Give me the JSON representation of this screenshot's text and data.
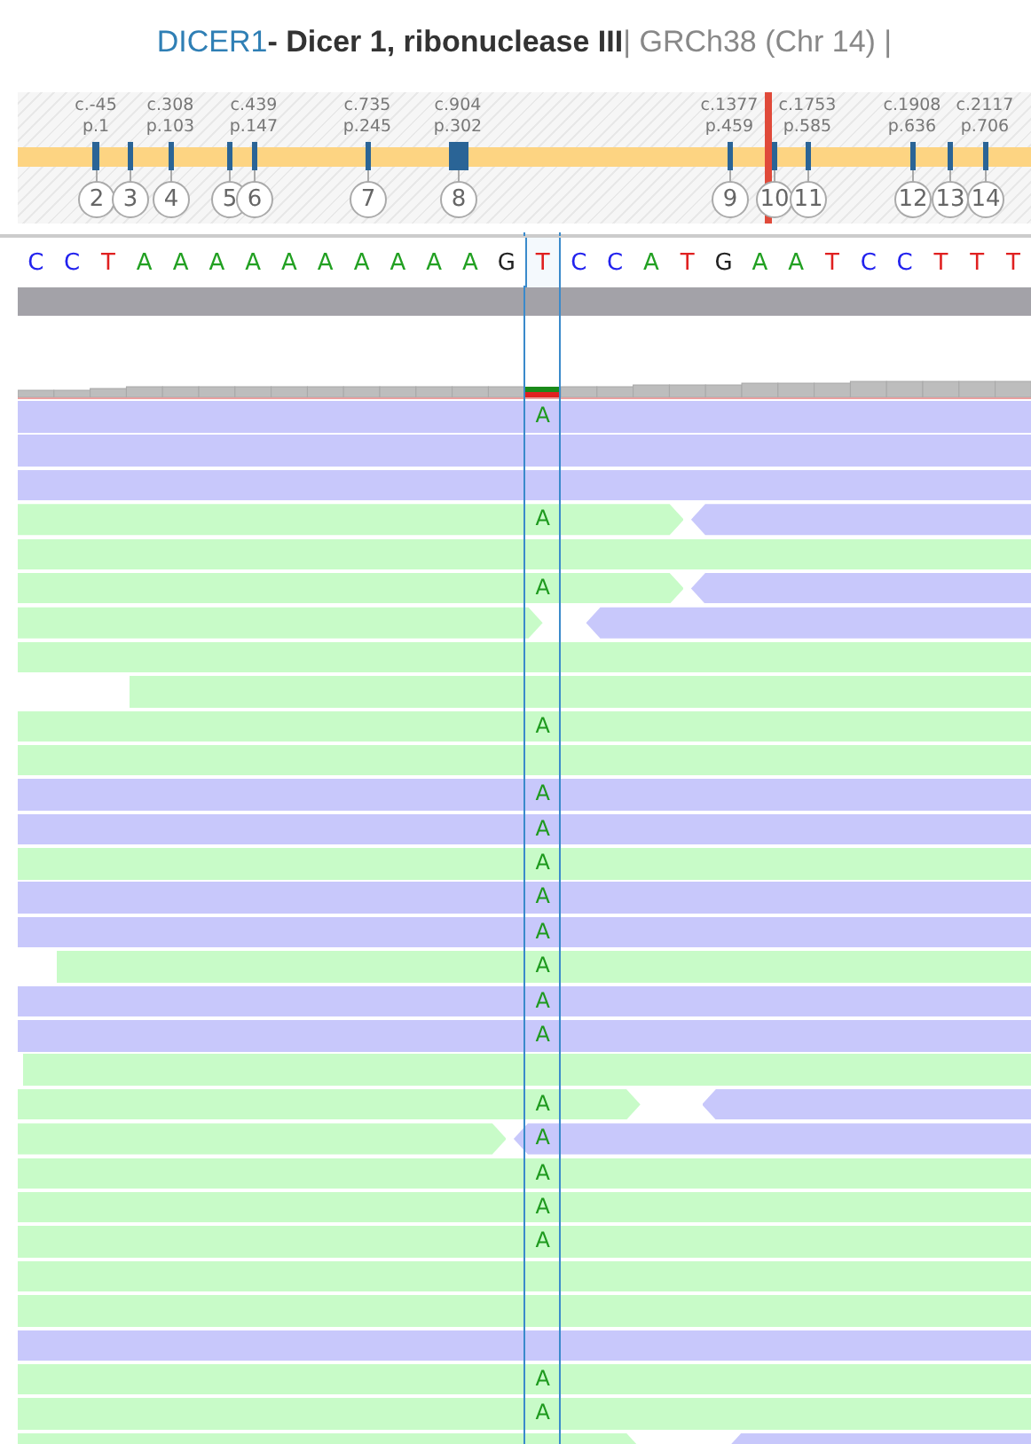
{
  "title": {
    "symbol": "DICER1",
    "name": " - Dicer 1, ribonuclease III",
    "assembly": " | GRCh38 (Chr 14) |"
  },
  "exons": [
    {
      "number": "2",
      "c_label": "c.-45",
      "p_label": "p.1"
    },
    {
      "number": "3"
    },
    {
      "number": "4",
      "c_label": "c.308",
      "p_label": "p.103"
    },
    {
      "number": "5"
    },
    {
      "number": "6",
      "c_label": "c.439",
      "p_label": "p.147"
    },
    {
      "number": "7",
      "c_label": "c.735",
      "p_label": "p.245"
    },
    {
      "number": "8",
      "c_label": "c.904",
      "p_label": "p.302"
    },
    {
      "number": "9",
      "c_label": "c.1377",
      "p_label": "p.459"
    },
    {
      "number": "10"
    },
    {
      "number": "11",
      "c_label": "c.1753",
      "p_label": "p.585"
    },
    {
      "number": "12",
      "c_label": "c.1908",
      "p_label": "p.636"
    },
    {
      "number": "13"
    },
    {
      "number": "14",
      "c_label": "c.2117",
      "p_label": "p.706"
    }
  ],
  "sequence": [
    {
      "base": "C",
      "color": "#2222ee",
      "selected": false
    },
    {
      "base": "C",
      "color": "#2222ee",
      "selected": false
    },
    {
      "base": "T",
      "color": "#e02020",
      "selected": false
    },
    {
      "base": "A",
      "color": "#22a022",
      "selected": false
    },
    {
      "base": "A",
      "color": "#22a022",
      "selected": false
    },
    {
      "base": "A",
      "color": "#22a022",
      "selected": false
    },
    {
      "base": "A",
      "color": "#22a022",
      "selected": false
    },
    {
      "base": "A",
      "color": "#22a022",
      "selected": false
    },
    {
      "base": "A",
      "color": "#22a022",
      "selected": false
    },
    {
      "base": "A",
      "color": "#22a022",
      "selected": false
    },
    {
      "base": "A",
      "color": "#22a022",
      "selected": false
    },
    {
      "base": "A",
      "color": "#22a022",
      "selected": false
    },
    {
      "base": "A",
      "color": "#22a022",
      "selected": false
    },
    {
      "base": "G",
      "color": "#222222",
      "selected": false
    },
    {
      "base": "T",
      "color": "#e02020",
      "selected": true
    },
    {
      "base": "C",
      "color": "#2222ee",
      "selected": false
    },
    {
      "base": "C",
      "color": "#2222ee",
      "selected": false
    },
    {
      "base": "A",
      "color": "#22a022",
      "selected": false
    },
    {
      "base": "T",
      "color": "#e02020",
      "selected": false
    },
    {
      "base": "G",
      "color": "#222222",
      "selected": false
    },
    {
      "base": "A",
      "color": "#22a022",
      "selected": false
    },
    {
      "base": "A",
      "color": "#22a022",
      "selected": false
    },
    {
      "base": "T",
      "color": "#e02020",
      "selected": false
    },
    {
      "base": "C",
      "color": "#2222ee",
      "selected": false
    },
    {
      "base": "C",
      "color": "#2222ee",
      "selected": false
    },
    {
      "base": "T",
      "color": "#e02020",
      "selected": false
    },
    {
      "base": "T",
      "color": "#e02020",
      "selected": false
    },
    {
      "base": "T",
      "color": "#e02020",
      "selected": false
    }
  ],
  "reads": [
    {
      "segments": [
        {
          "kind": "reverse"
        }
      ],
      "mismatch": "A"
    },
    {
      "segments": [
        {
          "kind": "reverse"
        }
      ]
    },
    {
      "segments": [
        {
          "kind": "reverse"
        }
      ]
    },
    {
      "segments": [
        {
          "kind": "forward"
        },
        {
          "kind": "reverse"
        }
      ],
      "mismatch": "A"
    },
    {
      "segments": [
        {
          "kind": "forward"
        }
      ]
    },
    {
      "segments": [
        {
          "kind": "forward"
        },
        {
          "kind": "reverse"
        }
      ],
      "mismatch": "A"
    },
    {
      "segments": [
        {
          "kind": "forward"
        },
        {
          "kind": "reverse"
        }
      ]
    },
    {
      "segments": [
        {
          "kind": "forward"
        }
      ]
    },
    {
      "segments": [
        {
          "kind": "forward"
        }
      ]
    },
    {
      "segments": [
        {
          "kind": "forward"
        }
      ],
      "mismatch": "A"
    },
    {
      "segments": [
        {
          "kind": "forward"
        }
      ]
    },
    {
      "segments": [
        {
          "kind": "reverse"
        }
      ],
      "mismatch": "A"
    },
    {
      "segments": [
        {
          "kind": "reverse"
        }
      ],
      "mismatch": "A"
    },
    {
      "segments": [
        {
          "kind": "forward"
        }
      ],
      "mismatch": "A"
    },
    {
      "segments": [
        {
          "kind": "reverse"
        }
      ],
      "mismatch": "A"
    },
    {
      "segments": [
        {
          "kind": "reverse"
        }
      ],
      "mismatch": "A"
    },
    {
      "segments": [
        {
          "kind": "forward"
        }
      ],
      "mismatch": "A"
    },
    {
      "segments": [
        {
          "kind": "reverse"
        }
      ],
      "mismatch": "A"
    },
    {
      "segments": [
        {
          "kind": "reverse"
        }
      ],
      "mismatch": "A"
    },
    {
      "segments": [
        {
          "kind": "forward"
        }
      ]
    },
    {
      "segments": [
        {
          "kind": "forward"
        },
        {
          "kind": "reverse"
        }
      ],
      "mismatch": "A"
    },
    {
      "segments": [
        {
          "kind": "forward"
        },
        {
          "kind": "reverse"
        }
      ],
      "mismatch": "A"
    },
    {
      "segments": [
        {
          "kind": "forward"
        }
      ],
      "mismatch": "A"
    },
    {
      "segments": [
        {
          "kind": "forward"
        }
      ],
      "mismatch": "A"
    },
    {
      "segments": [
        {
          "kind": "forward"
        }
      ],
      "mismatch": "A"
    },
    {
      "segments": [
        {
          "kind": "forward"
        }
      ]
    },
    {
      "segments": [
        {
          "kind": "forward"
        }
      ]
    },
    {
      "segments": [
        {
          "kind": "reverse"
        }
      ]
    },
    {
      "segments": [
        {
          "kind": "forward"
        }
      ],
      "mismatch": "A"
    },
    {
      "segments": [
        {
          "kind": "forward"
        }
      ],
      "mismatch": "A"
    },
    {
      "segments": [
        {
          "kind": "forward"
        },
        {
          "kind": "reverse"
        }
      ]
    }
  ]
}
